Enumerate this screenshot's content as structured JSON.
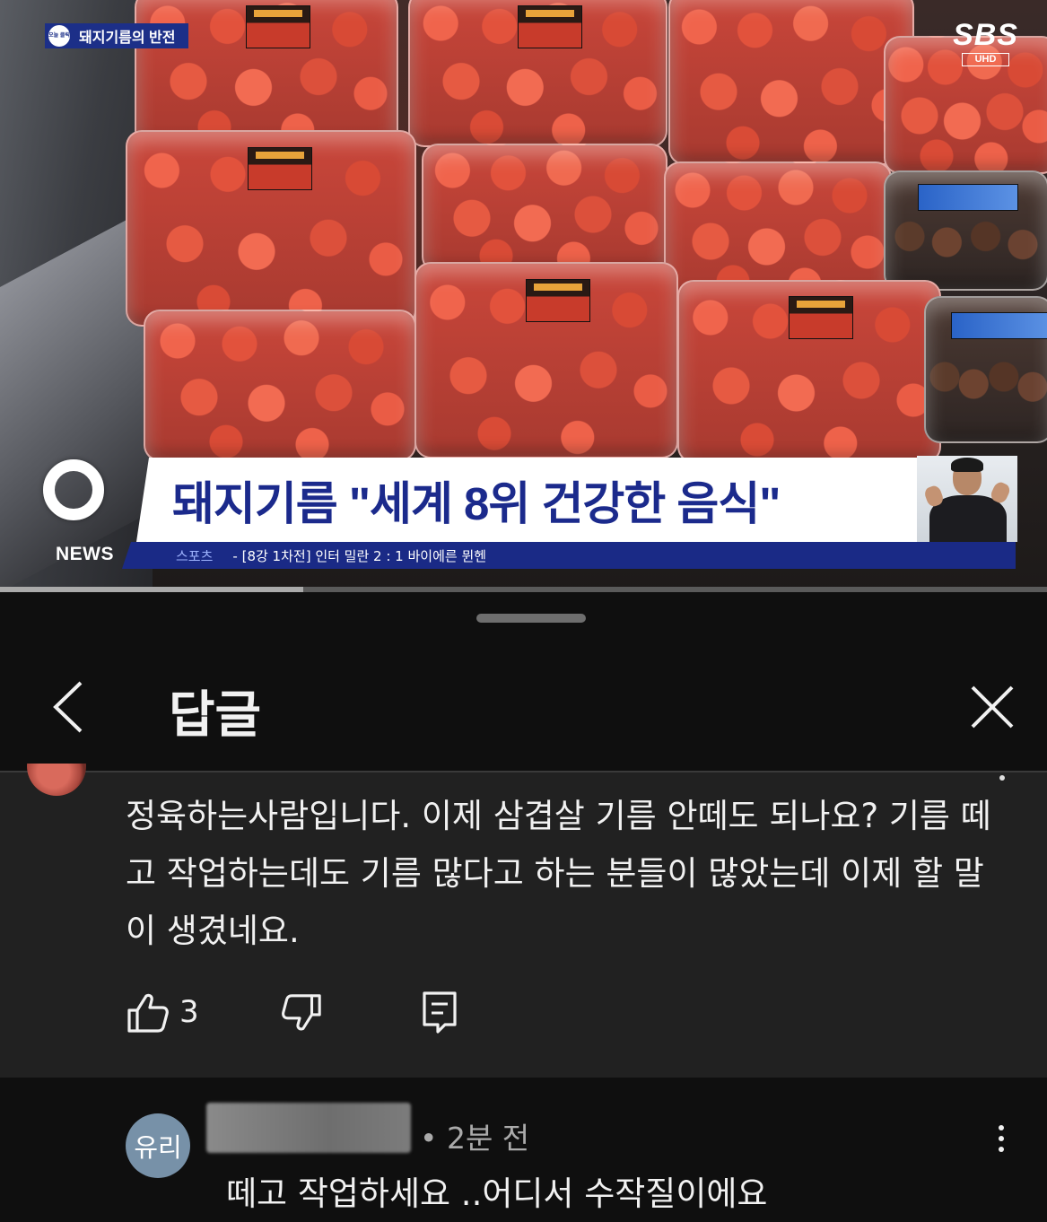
{
  "video": {
    "topic_tag": "돼지기름의 반전",
    "topic_badge": "오늘 클릭",
    "channel_logo": "SBS",
    "channel_sub": "UHD",
    "news_logo_text": "NEWS",
    "headline": "돼지기름 \"세계 8위 건강한 음식\"",
    "ticker_category": "스포츠",
    "ticker_text": "- [8강 1차전] 인터 밀란 2 : 1 바이에른 뮌헨",
    "progress_fraction": 0.29
  },
  "sheet": {
    "title": "답글",
    "back_icon": "chevron-left-icon",
    "close_icon": "close-icon"
  },
  "parent_comment": {
    "text": "정육하는사람입니다. 이제 삼겹살 기름 안떼도 되나요? 기름 떼고 작업하는데도 기름 많다고 하는 분들이 많았는데 이제 할 말이 생겼네요.",
    "like_count": "3"
  },
  "reply": {
    "avatar_text": "유리",
    "time": "• 2분 전",
    "text": "떼고 작업하세요 ..어디서 수작질이에요"
  }
}
